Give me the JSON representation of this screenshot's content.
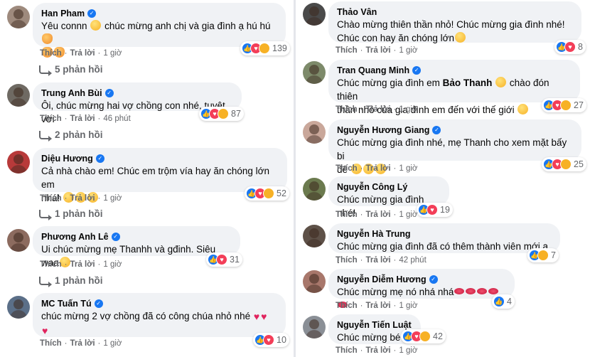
{
  "left": {
    "comments": [
      {
        "name": "Han Pham",
        "text": "Yêu connn",
        "text2": "chúc mừng anh chị và gia đình ạ hú hú",
        "reactions": "139",
        "like": "Thích",
        "reply": "Trả lời",
        "time": "1 giờ",
        "replies": "5 phản hồi",
        "avatar_color": "#9e8a7d"
      },
      {
        "name": "Trung Anh Bùi",
        "text": "Ôi, chúc mừng hai vợ chồng con nhé, tuyệt vời",
        "reactions": "87",
        "like": "Thích",
        "reply": "Trả lời",
        "time": "46 phút",
        "replies": "2 phản hồi",
        "avatar_color": "#6f6a63"
      },
      {
        "name": "Diệu Hương",
        "text": "Cả nhà chào em! Chúc em trộm vía hay ăn chóng lớn em",
        "text2": "nhá!",
        "reactions": "52",
        "like": "Thích",
        "reply": "Trả lời",
        "time": "1 giờ",
        "replies": "1 phản hồi",
        "avatar_color": "#b83a3a"
      },
      {
        "name": "Phương Anh Lê",
        "text": "Ui chúc mừng mẹ Thanhh và gđinh. Siêu waa",
        "reactions": "31",
        "like": "Thích",
        "reply": "Trả lời",
        "time": "1 giờ",
        "replies": "1 phản hồi",
        "avatar_color": "#8c6b5f"
      },
      {
        "name": "MC Tuấn Tú",
        "text": "chúc mừng 2 vợ chồng đã có công chúa nhỏ nhé",
        "reactions": "10",
        "like": "Thích",
        "reply": "Trả lời",
        "time": "1 giờ",
        "avatar_color": "#5b6f88"
      }
    ]
  },
  "right": {
    "comments": [
      {
        "name": "Thảo Vân",
        "text": "Chào mừng thiên thần nhỏ! Chúc mừng gia đình nhé!",
        "text2": "Chúc con hay ăn chóng lớn",
        "reactions": "8",
        "like": "Thích",
        "reply": "Trả lời",
        "time": "1 giờ",
        "avatar_color": "#4a4a4a"
      },
      {
        "name": "Tran Quang Minh",
        "text": "Chúc mừng gia đình em",
        "text_bold": "Bảo Thanh",
        "text_after": "chào đón thiên",
        "text2": "thần nhỏ của gia đình em đến với thế giới",
        "reactions": "27",
        "like": "Thích",
        "reply": "Trả lời",
        "time": "1 giờ",
        "avatar_color": "#7d8a6a"
      },
      {
        "name": "Nguyễn Hương Giang",
        "text": "Chúc mừng gia đình nhé, mẹ Thanh cho xem mặt bấy bi",
        "text2": "đê",
        "reactions": "25",
        "like": "Thích",
        "reply": "Trả lời",
        "time": "1 giờ",
        "avatar_color": "#c9a79a"
      },
      {
        "name": "Nguyễn Công Lý",
        "text": "Chúc mừng gia đình nhé!",
        "reactions": "19",
        "like": "Thích",
        "reply": "Trả lời",
        "time": "1 giờ",
        "avatar_color": "#6b7a4e"
      },
      {
        "name": "Nguyễn Hà Trung",
        "text": "Chúc mừng gia đình đã có thêm thành viên mới ạ !",
        "reactions": "7",
        "like": "Thích",
        "reply": "Trả lời",
        "time": "42 phút",
        "avatar_color": "#5e5148"
      },
      {
        "name": "Nguyễn Diễm Hương",
        "text": "Chúc mừng mẹ nó nhá nhá",
        "reactions": "4",
        "like": "Thích",
        "reply": "Trả lời",
        "time": "1 giờ",
        "avatar_color": "#a8776b"
      },
      {
        "name": "Nguyễn Tiến Luật",
        "text": "Chúc mừng bé",
        "reactions": "42",
        "like": "Thích",
        "reply": "Trả lời",
        "time": "1 giờ",
        "avatar_color": "#8a8f96"
      }
    ]
  },
  "colors": {
    "bubble": "#f0f2f5",
    "like": "#1877f2",
    "love": "#f33e58",
    "haha": "#f7b125",
    "meta": "#65676b"
  },
  "icons": [
    "verified-badge-icon",
    "like-reaction-icon",
    "love-reaction-icon",
    "haha-reaction-icon",
    "reply-arrow-icon"
  ]
}
